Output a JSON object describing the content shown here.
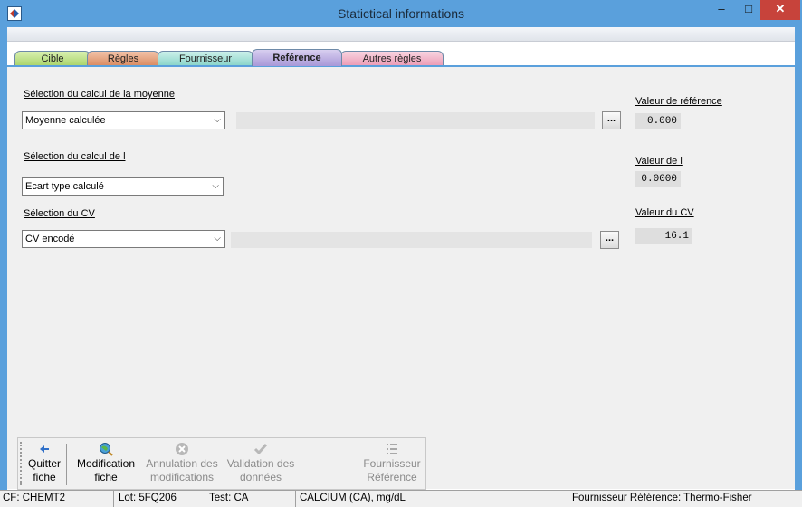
{
  "window": {
    "title": "Statictical informations",
    "minimize_glyph": "–",
    "maximize_glyph": "□",
    "close_glyph": "✕"
  },
  "tabs": [
    {
      "label": "Cible"
    },
    {
      "label": "Règles"
    },
    {
      "label": "Fournisseur"
    },
    {
      "label": "Reférence",
      "active": true
    },
    {
      "label": "Autres règles"
    }
  ],
  "form": {
    "moyenne": {
      "label": "Sélection du calcul de  la moyenne",
      "selected": "Moyenne calculée",
      "ref_label": "Valeur  de référence",
      "ref_value": "0.000"
    },
    "ecart": {
      "label": "Sélection du calcul de l",
      "selected": "Ecart type calculé",
      "ref_label": "Valeur de l",
      "ref_value": "0.0000"
    },
    "cv": {
      "label": "Sélection du  CV",
      "selected": "CV encodé",
      "ref_label": "Valeur du CV",
      "ref_value": "16.1"
    },
    "dots_label": "..."
  },
  "toolbar": {
    "quit": {
      "line1": "Quitter",
      "line2": "fiche",
      "icon": "arrow-left-icon"
    },
    "modify": {
      "line1": "Modification",
      "line2": "fiche",
      "icon": "globe-search-icon"
    },
    "cancel": {
      "line1": "Annulation des",
      "line2": "modifications",
      "icon": "cancel-circle-icon"
    },
    "validate": {
      "line1": "Validation des",
      "line2": "données",
      "icon": "check-icon"
    },
    "supplier_ref": {
      "line1": "Fournisseur",
      "line2": "Référence",
      "icon": "list-icon"
    }
  },
  "status": {
    "cf": "CF: CHEMT2",
    "lot": "Lot: 5FQ206",
    "test": "Test: CA",
    "analyte": "CALCIUM (CA), mg/dL",
    "supplier": "Fournisseur  Référence: Thermo-Fisher"
  },
  "colors": {
    "titlebar": "#5aa0dc",
    "close_button": "#c7433b",
    "tab_cible": "#a8d46a",
    "tab_regles": "#d98a60",
    "tab_fournisseur": "#88d4c8",
    "tab_reference": "#a898d8",
    "tab_autres": "#ec9ab4"
  }
}
